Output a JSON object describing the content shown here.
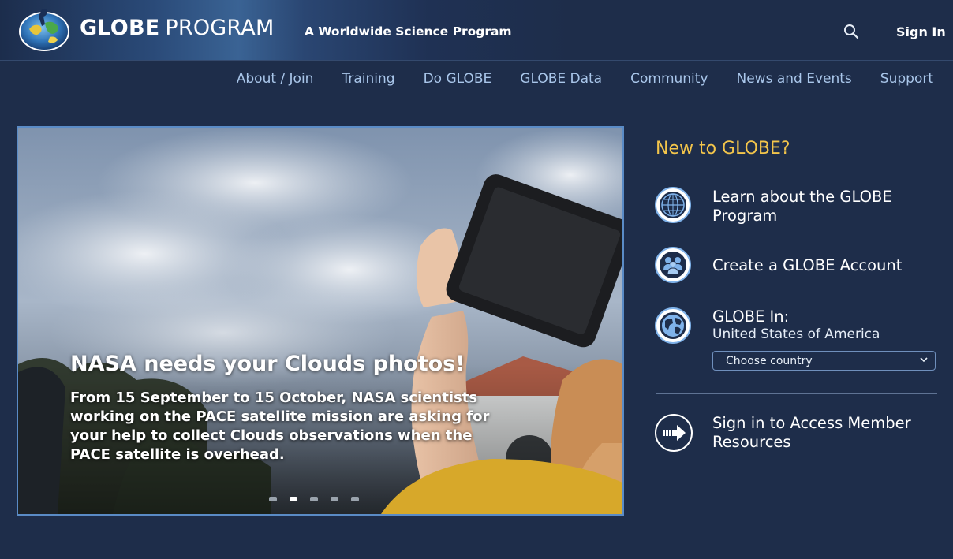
{
  "header": {
    "brand_bold": "GLOBE",
    "brand_light": "PROGRAM",
    "tagline": "A Worldwide Science Program",
    "sign_in": "Sign In",
    "icons": {
      "logo": "globe-logo",
      "search": "search-icon"
    }
  },
  "nav": {
    "items": [
      {
        "label": "About / Join"
      },
      {
        "label": "Training"
      },
      {
        "label": "Do GLOBE"
      },
      {
        "label": "GLOBE Data"
      },
      {
        "label": "Community"
      },
      {
        "label": "News and Events"
      },
      {
        "label": "Support"
      }
    ]
  },
  "hero": {
    "title": "NASA needs your Clouds photos!",
    "text": "From 15 September to 15 October, NASA scientists working on the PACE satellite mission are asking for your help to collect Clouds observations when the PACE satellite is overhead.",
    "slide_count": 5,
    "active_slide": 2
  },
  "sidebar": {
    "heading": "New to GLOBE?",
    "learn": {
      "label_line1": "Learn about the GLOBE",
      "label_line2": "Program",
      "icon": "globe-grid-icon"
    },
    "create": {
      "label": "Create a GLOBE Account",
      "icon": "people-icon"
    },
    "globe_in": {
      "label": "GLOBE In:",
      "country": "United States of America",
      "select_value": "Choose country",
      "icon": "world-map-icon"
    },
    "member": {
      "label_line1": "Sign in to Access Member",
      "label_line2": "Resources",
      "icon": "arrow-right-icon"
    }
  },
  "colors": {
    "background": "#1e2d4a",
    "nav_link": "#a9c6ea",
    "accent_heading": "#f3c54b",
    "hero_border": "#5a8bc6"
  }
}
